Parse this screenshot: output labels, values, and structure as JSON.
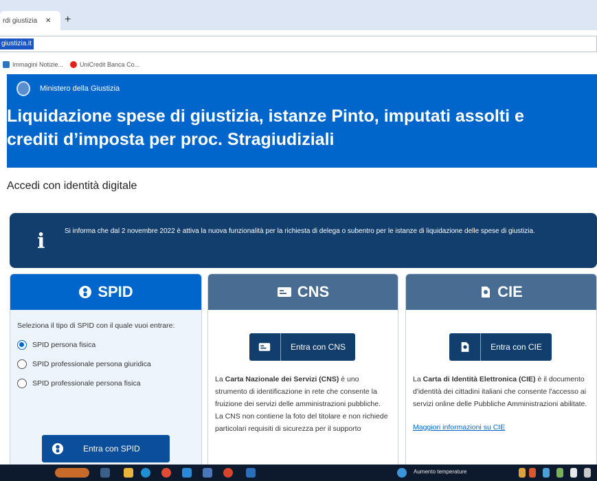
{
  "browser": {
    "tab_title": "rdi giustizia",
    "tab_close": "✕",
    "new_tab": "+",
    "url": "giustizia.it",
    "bookmarks": [
      "Immagini Notizie...",
      "UniCredit Banca Co..."
    ]
  },
  "header": {
    "ministry": "Ministero della Giustizia",
    "title_line1": "Liquidazione spese di giustizia, istanze Pinto, imputati assolti e",
    "title_line2": "crediti d’imposta per proc. Stragiudiziali"
  },
  "subheading": "Accedi con identità digitale",
  "info": {
    "icon": "i",
    "text": "Si informa che dal 2 novembre 2022 è attiva la nuova funzionalità per la richiesta di delega o subentro per le istanze di liquidazione delle spese di giustizia."
  },
  "spid": {
    "title": "SPID",
    "prompt": "Seleziona il tipo di SPID con il quale vuoi entrare:",
    "options": [
      "SPID persona fisica",
      "SPID professionale persona giuridica",
      "SPID professionale persona fisica"
    ],
    "selected": "SPID persona fisica",
    "button": "Entra con SPID"
  },
  "cns": {
    "title": "CNS",
    "button": "Entra con CNS",
    "desc_pre": "La ",
    "desc_bold": "Carta Nazionale dei Servizi (CNS)",
    "desc_rest": " è uno strumento di identificazione in rete che consente la fruizione dei servizi delle amministrazioni pubbliche. La CNS non contiene la foto del titolare e non richiede particolari requisiti di sicurezza per il supporto"
  },
  "cie": {
    "title": "CIE",
    "button": "Entra con CIE",
    "desc_pre": "La ",
    "desc_bold": "Carta di Identità Elettronica (CIE)",
    "desc_rest": " è il documento d'identità dei cittadini italiani che consente l'accesso ai servizi online delle Pubbliche Amministrazioni abilitate.",
    "link": "Maggiori informazioni su CIE"
  },
  "taskbar": {
    "status_text": "Aumento temperature"
  },
  "colors": {
    "primary": "#0066cc",
    "dark_blue": "#123e6e",
    "card_header": "#496c92"
  }
}
